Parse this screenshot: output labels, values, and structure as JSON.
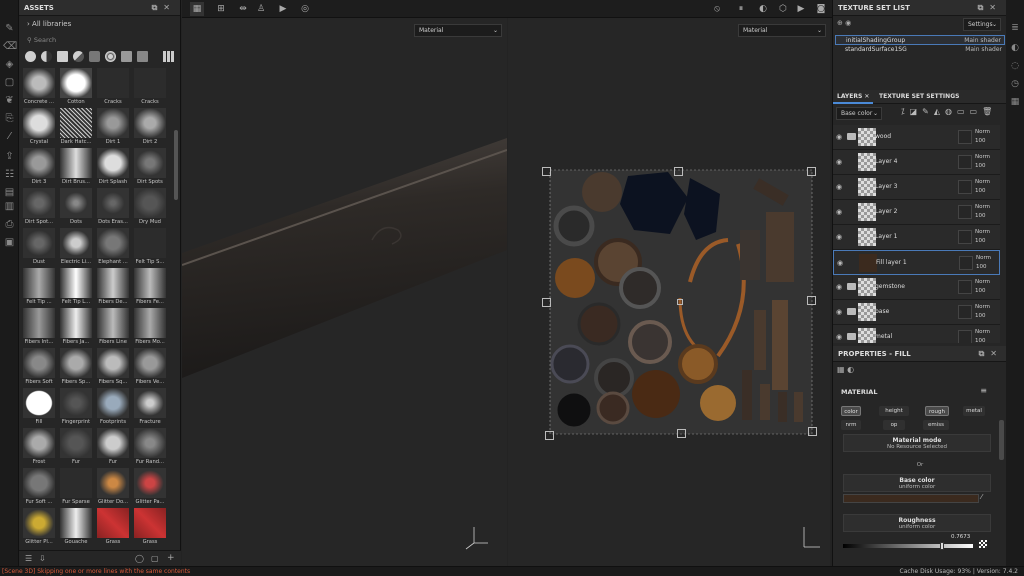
{
  "assets": {
    "title": "ASSETS",
    "libraries": "All libraries",
    "search_placeholder": "Search",
    "items": [
      {
        "label": "Concrete ..."
      },
      {
        "label": "Cotton"
      },
      {
        "label": "Cracks"
      },
      {
        "label": "Cracks"
      },
      {
        "label": "Crystal"
      },
      {
        "label": "Dark Hatc..."
      },
      {
        "label": "Dirt 1"
      },
      {
        "label": "Dirt 2"
      },
      {
        "label": "Dirt 3"
      },
      {
        "label": "Dirt Brus..."
      },
      {
        "label": "Dirt Splash"
      },
      {
        "label": "Dirt Spots"
      },
      {
        "label": "Dirt Spot..."
      },
      {
        "label": "Dots"
      },
      {
        "label": "Dots Eras..."
      },
      {
        "label": "Dry Mud"
      },
      {
        "label": "Dust"
      },
      {
        "label": "Electric Li..."
      },
      {
        "label": "Elephant ..."
      },
      {
        "label": "Felt Tip S..."
      },
      {
        "label": "Felt Tip ..."
      },
      {
        "label": "Felt Tip L..."
      },
      {
        "label": "Fibers De..."
      },
      {
        "label": "Fibers Fe..."
      },
      {
        "label": "Fibers Int..."
      },
      {
        "label": "Fibers Ja..."
      },
      {
        "label": "Fibers Line"
      },
      {
        "label": "Fibers Mo..."
      },
      {
        "label": "Fibers Soft"
      },
      {
        "label": "Fibers Sp..."
      },
      {
        "label": "Fibers Sq..."
      },
      {
        "label": "Fibers Ve..."
      },
      {
        "label": "Fill"
      },
      {
        "label": "Fingerprint"
      },
      {
        "label": "Footprints"
      },
      {
        "label": "Fracture"
      },
      {
        "label": "Frost"
      },
      {
        "label": "Fur"
      },
      {
        "label": "Fur"
      },
      {
        "label": "Fur Rand..."
      },
      {
        "label": "Fur Soft ..."
      },
      {
        "label": "Fur Sparse"
      },
      {
        "label": "Glitter Do..."
      },
      {
        "label": "Glitter Pa..."
      },
      {
        "label": "Glitter Pl..."
      },
      {
        "label": "Gouache"
      },
      {
        "label": "Grass"
      },
      {
        "label": "Grass"
      }
    ]
  },
  "viewport": {
    "left_mode": "Material",
    "right_mode": "Material"
  },
  "texture_set_list": {
    "title": "TEXTURE SET LIST",
    "settings_label": "Settings",
    "sets": [
      {
        "name": "initialShadingGroup",
        "shader": "Main shader"
      },
      {
        "name": "standardSurface1SG",
        "shader": "Main shader"
      }
    ]
  },
  "layers_panel": {
    "tab_layers": "LAYERS",
    "tab_settings": "TEXTURE SET SETTINGS",
    "channel": "Base color",
    "layers": [
      {
        "name": "wood",
        "blend": "Norm",
        "opacity": "100",
        "folder": true
      },
      {
        "name": "Layer 4",
        "blend": "Norm",
        "opacity": "100",
        "folder": false
      },
      {
        "name": "Layer 3",
        "blend": "Norm",
        "opacity": "100",
        "folder": false
      },
      {
        "name": "Layer 2",
        "blend": "Norm",
        "opacity": "100",
        "folder": false
      },
      {
        "name": "Layer 1",
        "blend": "Norm",
        "opacity": "100",
        "folder": false
      },
      {
        "name": "Fill layer 1",
        "blend": "Norm",
        "opacity": "100",
        "folder": false
      },
      {
        "name": "gemstone",
        "blend": "Norm",
        "opacity": "100",
        "folder": true
      },
      {
        "name": "base",
        "blend": "Norm",
        "opacity": "100",
        "folder": true
      },
      {
        "name": "metal",
        "blend": "Norm",
        "opacity": "100",
        "folder": true
      }
    ]
  },
  "properties": {
    "title": "PROPERTIES - FILL",
    "section": "MATERIAL",
    "channels": [
      "color",
      "height",
      "rough",
      "metal",
      "nrm",
      "op",
      "emiss"
    ],
    "material_mode_label": "Material mode",
    "material_mode_value": "No Resource Selected",
    "or_label": "Or",
    "base_color_label": "Base color",
    "base_color_sub": "uniform color",
    "roughness_label": "Roughness",
    "roughness_sub": "uniform color",
    "roughness_value": "0.7673",
    "roughness_fraction": 0.7673,
    "base_color_hex": "#3b2a1e"
  },
  "status": {
    "message": "[Scene 3D] Skipping one or more lines with the same contents",
    "cache_label": "Cache Disk Usage:",
    "cache_value": "93%",
    "version": "| Version: 7.4.2"
  }
}
